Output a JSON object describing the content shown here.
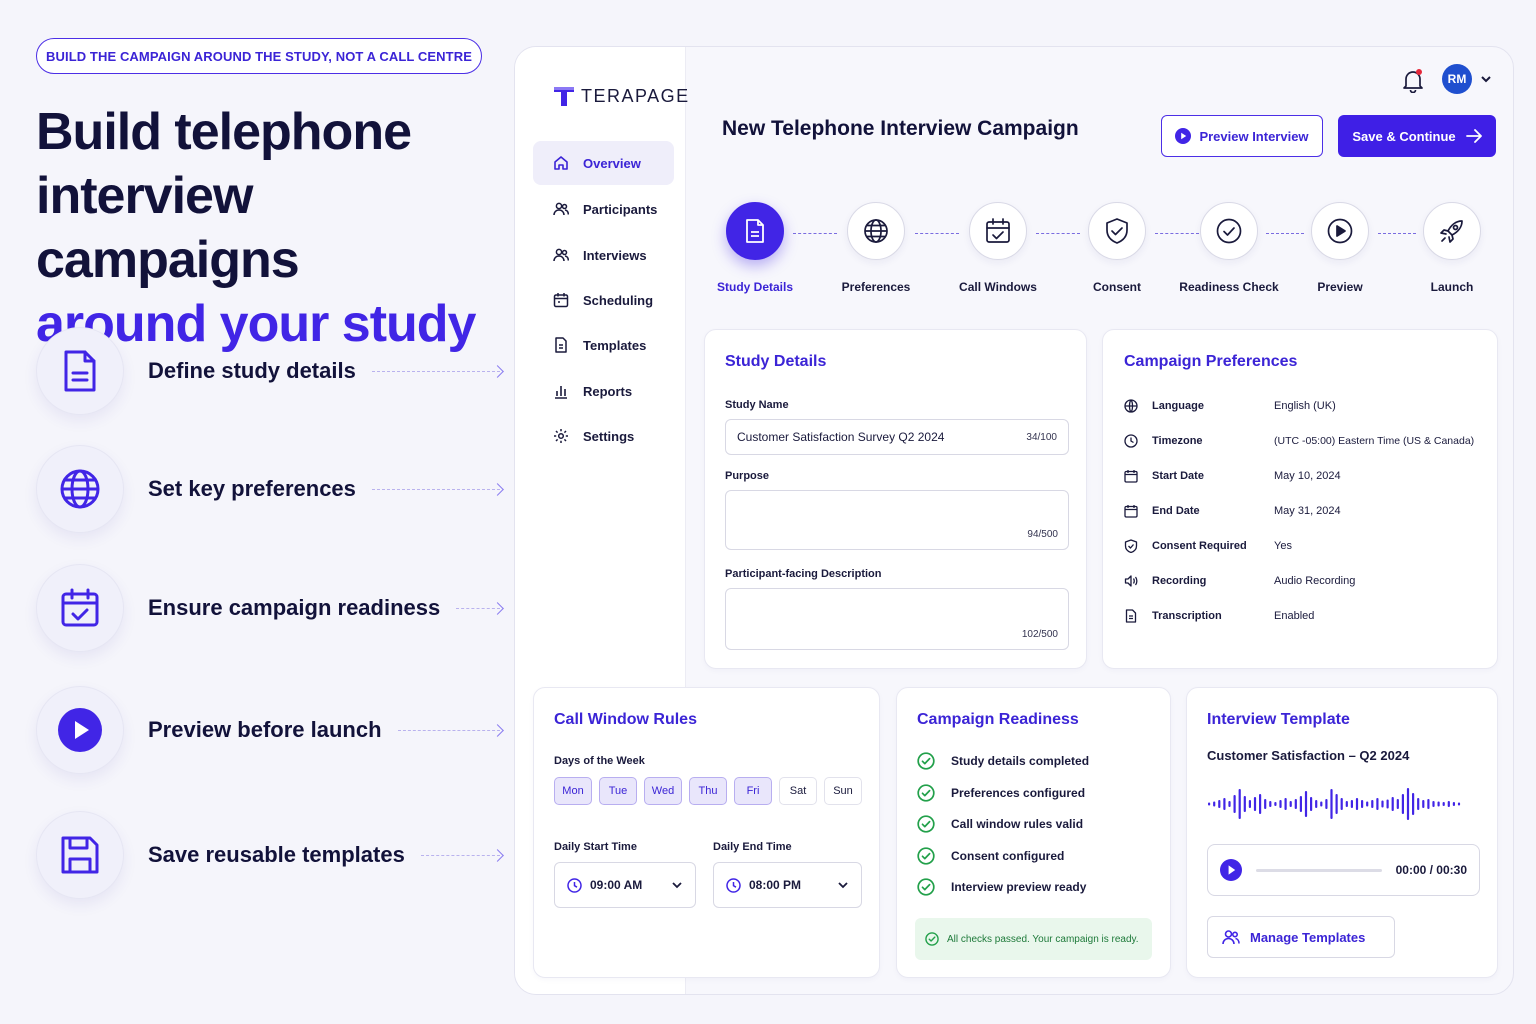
{
  "marketing": {
    "tagline": "BUILD THE CAMPAIGN AROUND THE STUDY, NOT A CALL CENTRE",
    "hero_line1": "Build telephone",
    "hero_line2": "interview campaigns",
    "hero_line3": "around your study",
    "features": [
      {
        "label": "Define study details",
        "icon": "document-icon"
      },
      {
        "label": "Set key preferences",
        "icon": "globe-icon"
      },
      {
        "label": "Ensure campaign readiness",
        "icon": "calendar-check-icon"
      },
      {
        "label": "Preview before launch",
        "icon": "play-icon"
      },
      {
        "label": "Save reusable templates",
        "icon": "save-icon"
      }
    ]
  },
  "app": {
    "logo": "TERAPAGE",
    "nav": [
      {
        "label": "Overview",
        "icon": "home-icon",
        "active": true
      },
      {
        "label": "Participants",
        "icon": "users-icon"
      },
      {
        "label": "Interviews",
        "icon": "users-icon"
      },
      {
        "label": "Scheduling",
        "icon": "calendar-icon"
      },
      {
        "label": "Templates",
        "icon": "file-icon"
      },
      {
        "label": "Reports",
        "icon": "bar-chart-icon"
      },
      {
        "label": "Settings",
        "icon": "gear-icon"
      }
    ],
    "page_title": "New Telephone Interview Campaign",
    "preview_button": "Preview Interview",
    "save_button": "Save & Continue",
    "user_initials": "RM",
    "steps": [
      {
        "label": "Study Details",
        "icon": "document-icon",
        "active": true
      },
      {
        "label": "Preferences",
        "icon": "globe-icon"
      },
      {
        "label": "Call Windows",
        "icon": "calendar-check-icon"
      },
      {
        "label": "Consent",
        "icon": "shield-check-icon"
      },
      {
        "label": "Readiness Check",
        "icon": "check-circle-icon"
      },
      {
        "label": "Preview",
        "icon": "play-circle-icon"
      },
      {
        "label": "Launch",
        "icon": "rocket-icon"
      }
    ],
    "study_details": {
      "title": "Study Details",
      "study_name_label": "Study Name",
      "study_name_value": "Customer Satisfaction Survey Q2 2024",
      "study_name_count": "34/100",
      "purpose_label": "Purpose",
      "purpose_count": "94/500",
      "description_label": "Participant-facing Description",
      "description_count": "102/500"
    },
    "preferences": {
      "title": "Campaign Preferences",
      "rows": [
        {
          "key": "Language",
          "value": "English (UK)",
          "icon": "language-icon"
        },
        {
          "key": "Timezone",
          "value": "(UTC -05:00) Eastern Time (US & Canada)",
          "icon": "clock-icon"
        },
        {
          "key": "Start Date",
          "value": "May 10, 2024",
          "icon": "calendar-icon"
        },
        {
          "key": "End Date",
          "value": "May 31, 2024",
          "icon": "calendar-icon"
        },
        {
          "key": "Consent Required",
          "value": "Yes",
          "icon": "shield-check-icon"
        },
        {
          "key": "Recording",
          "value": "Audio Recording",
          "icon": "speaker-icon"
        },
        {
          "key": "Transcription",
          "value": "Enabled",
          "icon": "file-text-icon"
        }
      ]
    },
    "call_window": {
      "title": "Call Window Rules",
      "days_label": "Days of the Week",
      "days": [
        {
          "label": "Mon",
          "on": true
        },
        {
          "label": "Tue",
          "on": true
        },
        {
          "label": "Wed",
          "on": true
        },
        {
          "label": "Thu",
          "on": true
        },
        {
          "label": "Fri",
          "on": true
        },
        {
          "label": "Sat",
          "on": false
        },
        {
          "label": "Sun",
          "on": false
        }
      ],
      "start_label": "Daily Start Time",
      "start_value": "09:00 AM",
      "end_label": "Daily End Time",
      "end_value": "08:00 PM"
    },
    "readiness": {
      "title": "Campaign Readiness",
      "checks": [
        "Study details completed",
        "Preferences configured",
        "Call window rules valid",
        "Consent configured",
        "Interview preview ready"
      ],
      "status": "All checks passed. Your campaign is ready."
    },
    "template": {
      "title": "Interview Template",
      "name": "Customer Satisfaction – Q2 2024",
      "time": "00:00 / 00:30",
      "manage_button": "Manage Templates"
    }
  },
  "colors": {
    "accent": "#4125e6",
    "success": "#22a04a",
    "text": "#12123a"
  }
}
